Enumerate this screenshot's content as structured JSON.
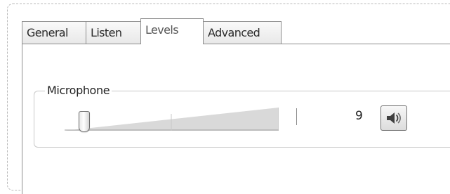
{
  "tabs": [
    {
      "label": "General"
    },
    {
      "label": "Listen"
    },
    {
      "label": "Levels"
    },
    {
      "label": "Advanced"
    }
  ],
  "active_tab": "Levels",
  "levels": {
    "microphone": {
      "label": "Microphone",
      "value": "9",
      "mute_icon": "speaker-icon",
      "muted": false
    }
  }
}
